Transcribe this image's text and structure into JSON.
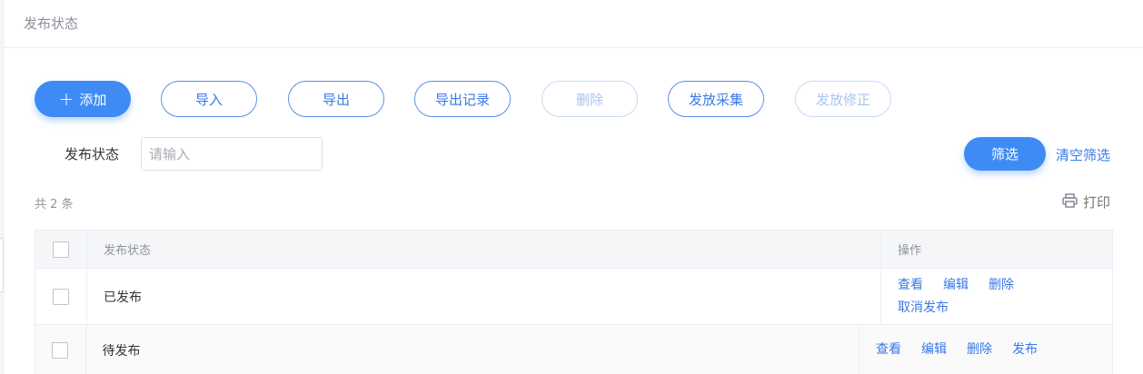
{
  "page": {
    "title": "发布状态"
  },
  "toolbar": {
    "add": "添加",
    "import": "导入",
    "export": "导出",
    "export_log": "导出记录",
    "delete": "删除",
    "publish_collect": "发放采集",
    "publish_fix": "发放修正"
  },
  "filter": {
    "label": "发布状态",
    "placeholder": "请输入",
    "value": "",
    "submit": "筛选",
    "clear": "清空筛选"
  },
  "summary": {
    "total": "共 2 条",
    "print": "打印"
  },
  "table": {
    "headers": {
      "status": "发布状态",
      "actions": "操作"
    },
    "rows": [
      {
        "status": "已发布",
        "actions": [
          "查看",
          "编辑",
          "删除",
          "取消发布"
        ]
      },
      {
        "status": "待发布",
        "actions": [
          "查看",
          "编辑",
          "删除",
          "发布"
        ]
      }
    ]
  },
  "colors": {
    "primary": "#3e8bf5",
    "link": "#3a79e6",
    "disabled": "#aac4f0"
  },
  "icons": {
    "add": "plus-icon",
    "print": "printer-icon"
  }
}
